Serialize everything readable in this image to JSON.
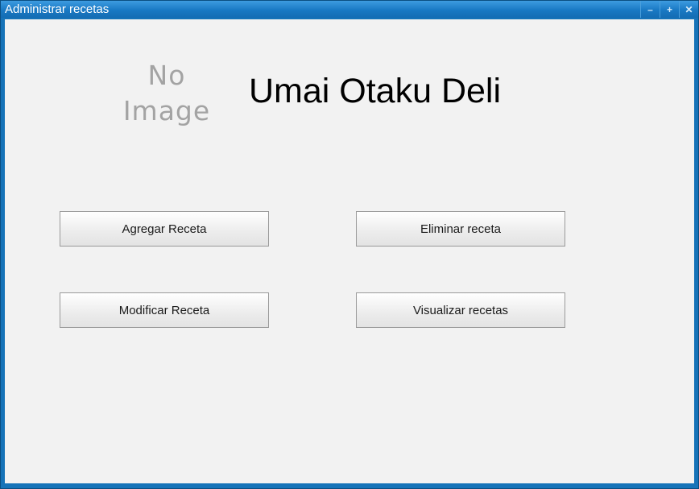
{
  "window": {
    "title": "Administrar recetas",
    "controls": {
      "minimize_glyph": "–",
      "maximize_glyph": "+",
      "close_glyph": "✕"
    }
  },
  "header": {
    "placeholder_line1": "No",
    "placeholder_line2": "Image",
    "app_title": "Umai Otaku Deli"
  },
  "actions": {
    "add_recipe": "Agregar Receta",
    "delete_recipe": "Eliminar receta",
    "modify_recipe": "Modificar Receta",
    "view_recipes": "Visualizar recetas"
  },
  "colors": {
    "titlebar": "#1979c4",
    "content_background": "#f2f2f2",
    "placeholder_text": "#a3a3a3"
  }
}
